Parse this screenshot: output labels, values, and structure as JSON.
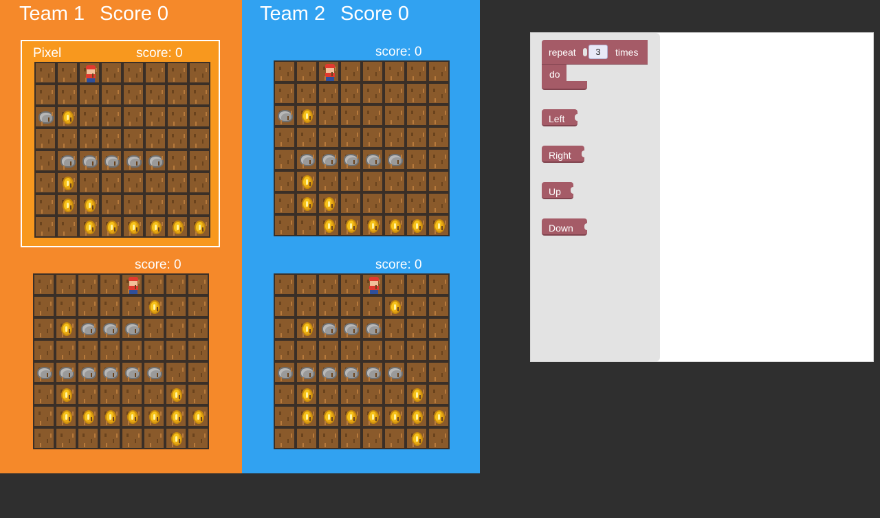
{
  "teams": [
    {
      "name": "Team 1",
      "score_text": "Score 0",
      "color": "#f5892a",
      "boards": [
        {
          "name": "Pixel",
          "score_text": "score: 0",
          "selected": true,
          "rows": [
            "..P.....",
            "........",
            "RC......",
            "........",
            ".RRRRR..",
            ".C......",
            ".CC.....",
            "..CCCCCC"
          ]
        },
        {
          "name": "",
          "score_text": "score: 0",
          "selected": false,
          "rows": [
            "....P...",
            ".....C..",
            ".CRRR...",
            "........",
            "RRRRRR..",
            ".C....C.",
            ".CCCCCCC",
            "......C."
          ]
        }
      ]
    },
    {
      "name": "Team 2",
      "score_text": "Score 0",
      "color": "#31a2f1",
      "boards": [
        {
          "name": "",
          "score_text": "score: 0",
          "selected": false,
          "rows": [
            "..P.....",
            "........",
            "RC......",
            "........",
            ".RRRRR..",
            ".C......",
            ".CC.....",
            "..CCCCCC"
          ]
        },
        {
          "name": "",
          "score_text": "score: 0",
          "selected": false,
          "rows": [
            "....P...",
            ".....C..",
            ".CRRR...",
            "........",
            "RRRRRR..",
            ".C....C.",
            ".CCCCCCC",
            "......C."
          ]
        }
      ]
    }
  ],
  "toolbox": {
    "repeat": {
      "label": "repeat",
      "count": "3",
      "times_label": "times",
      "do_label": "do"
    },
    "left_label": "Left",
    "right_label": "Right",
    "up_label": "Up",
    "down_label": "Down",
    "block_color": "#a55b67"
  },
  "legend": {
    "P": "player-icon",
    "R": "rock-icon",
    "C": "coin-icon",
    ".": "dirt-tile"
  }
}
